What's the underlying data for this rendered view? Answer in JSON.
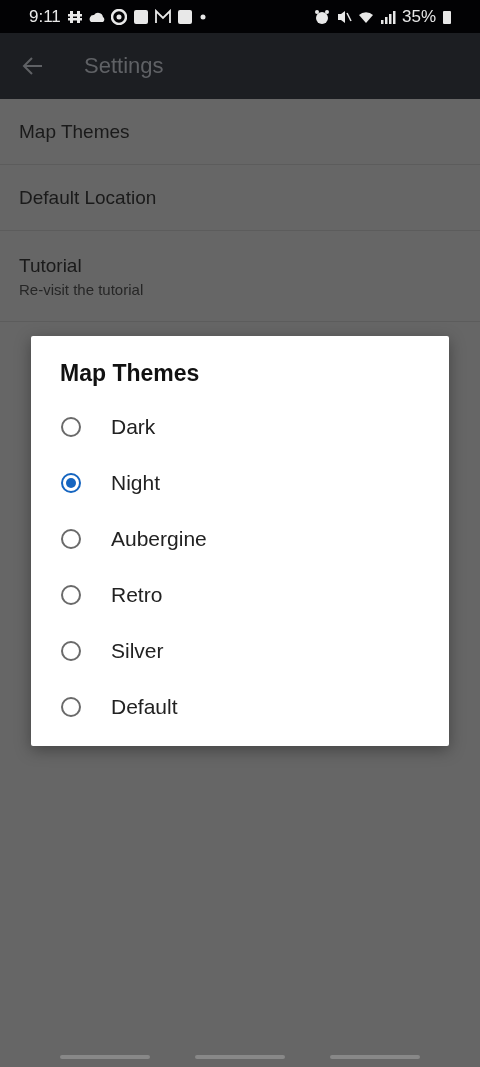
{
  "status_bar": {
    "time": "9:11",
    "battery": "35%"
  },
  "app_bar": {
    "title": "Settings"
  },
  "settings": [
    {
      "title": "Map Themes"
    },
    {
      "title": "Default Location"
    },
    {
      "title": "Tutorial",
      "subtitle": "Re-visit the tutorial"
    }
  ],
  "dialog": {
    "title": "Map Themes",
    "options": [
      {
        "label": "Dark",
        "selected": false
      },
      {
        "label": "Night",
        "selected": true
      },
      {
        "label": "Aubergine",
        "selected": false
      },
      {
        "label": "Retro",
        "selected": false
      },
      {
        "label": "Silver",
        "selected": false
      },
      {
        "label": "Default",
        "selected": false
      }
    ]
  }
}
